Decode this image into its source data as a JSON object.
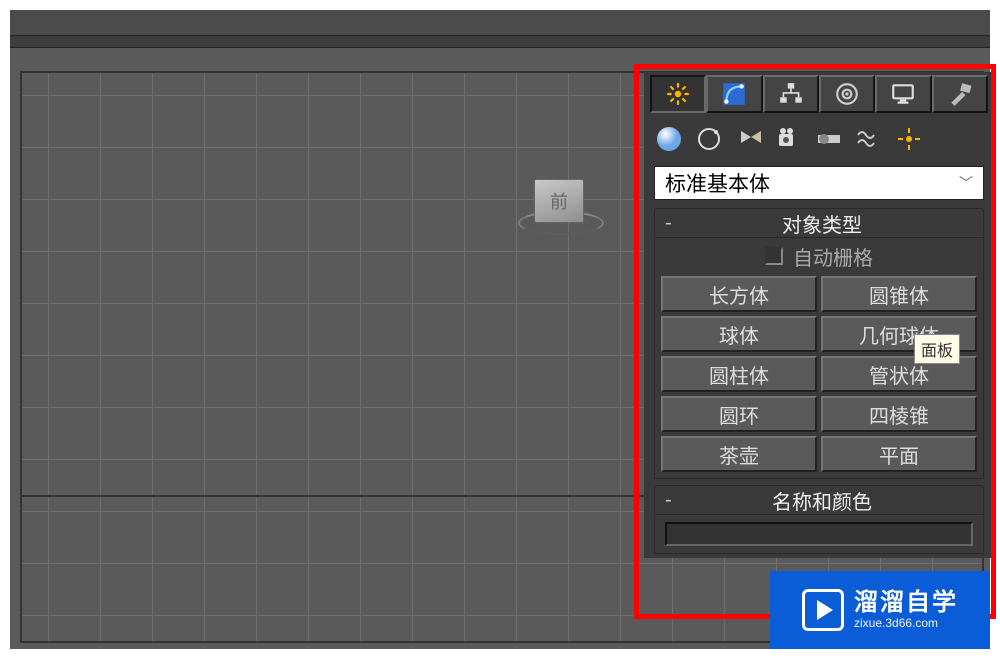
{
  "viewport": {
    "cube_face_label": "前"
  },
  "panel": {
    "tabs": [
      "create",
      "modify",
      "hierarchy",
      "motion",
      "display",
      "utilities"
    ],
    "sub_icons": [
      "geometry",
      "shapes",
      "lights",
      "cameras",
      "helpers",
      "space-warps",
      "systems"
    ],
    "dropdown": {
      "selected": "标准基本体"
    },
    "rollout_object_type": {
      "title": "对象类型",
      "autogrid_label": "自动栅格",
      "buttons": [
        "长方体",
        "圆锥体",
        "球体",
        "几何球体",
        "圆柱体",
        "管状体",
        "圆环",
        "四棱锥",
        "茶壶",
        "平面"
      ]
    },
    "rollout_name_color": {
      "title": "名称和颜色"
    },
    "tooltip": "面板"
  },
  "watermark": {
    "title": "溜溜自学",
    "url": "zixue.3d66.com"
  }
}
